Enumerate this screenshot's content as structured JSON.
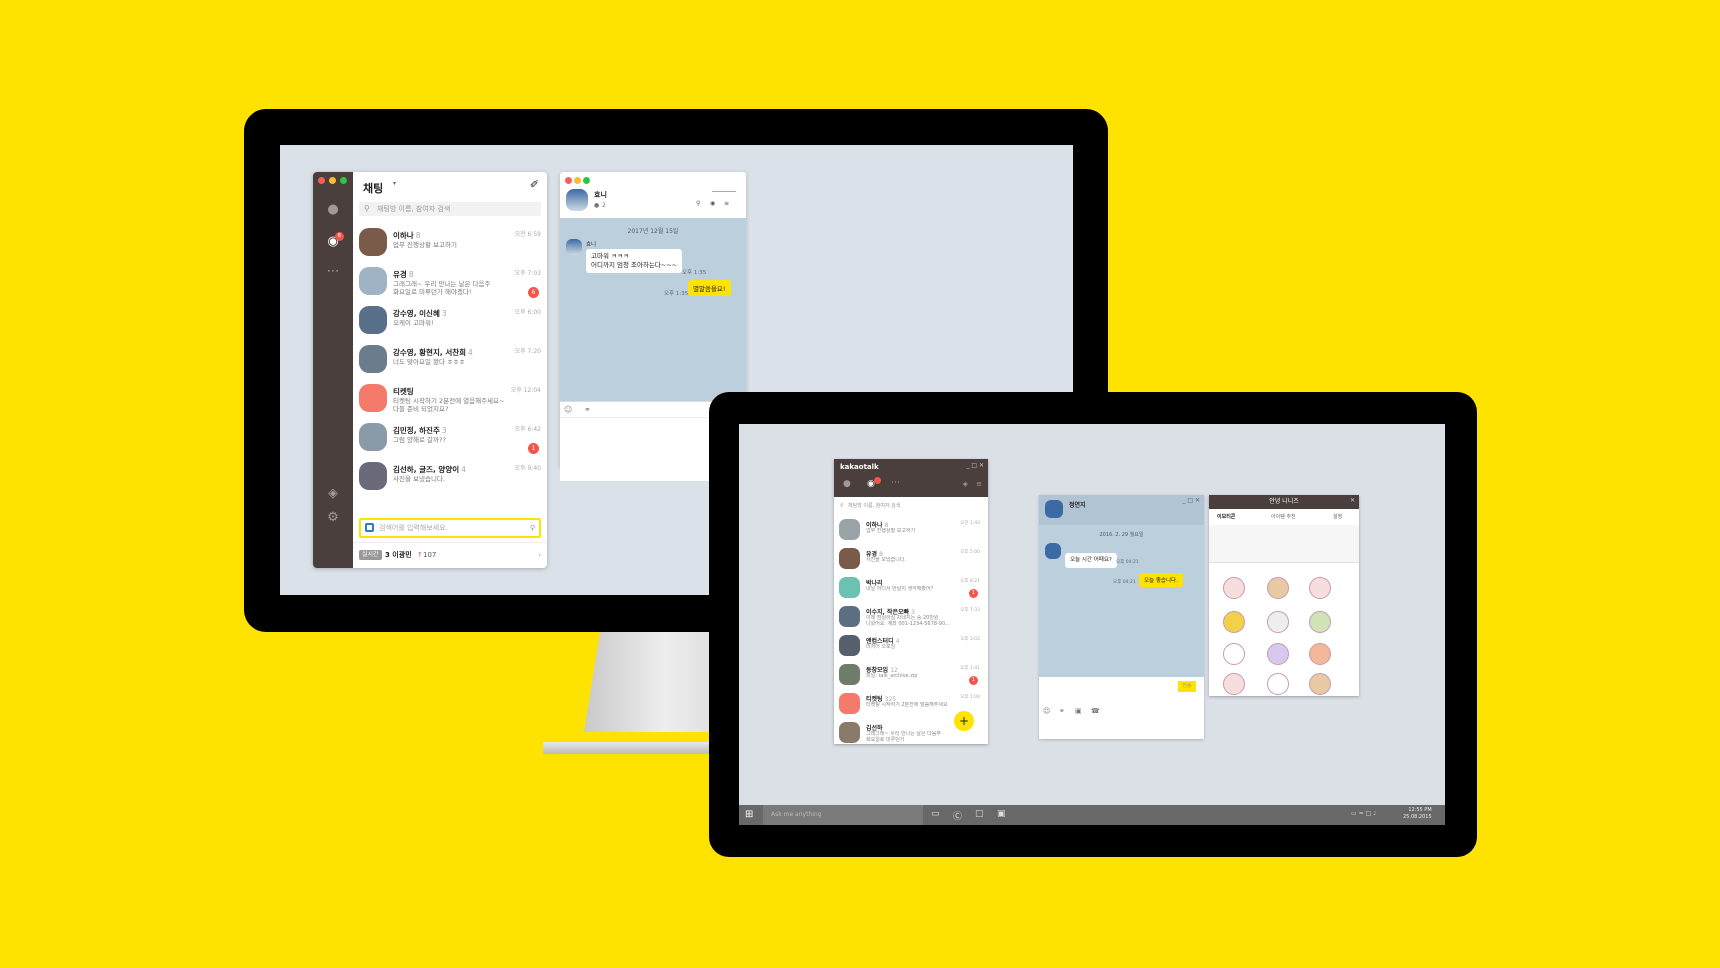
{
  "mac_list": {
    "title": "채팅",
    "search_placeholder": "채팅방 이름, 참여자 검색",
    "unread_badge": "6",
    "chats": [
      {
        "name": "이하나",
        "count": "8",
        "message": "업무 진행상황 보고하기",
        "time": "오전 6:59",
        "badge": ""
      },
      {
        "name": "유경",
        "count": "8",
        "message": "그래그래~ 우리 만나는 날은 다음주\n화요일로 미루던가 해야겠다!",
        "time": "오후 7:03",
        "badge": "6"
      },
      {
        "name": "강수영, 이신혜",
        "count": "3",
        "message": "오케이 고마워!",
        "time": "오후 6:00",
        "badge": ""
      },
      {
        "name": "강수영, 황현지, 서찬희",
        "count": "4",
        "message": "너도 맞아요일 봤다 ㅎㅎㅎ",
        "time": "오후 7:20",
        "badge": ""
      },
      {
        "name": "티켓팅",
        "count": "",
        "message": "티켓팅 시작하기 2분전에 열음해주세요~\n다들 준비 되었지요?",
        "time": "오후 12:04",
        "badge": ""
      },
      {
        "name": "김민정, 하진주",
        "count": "3",
        "message": "그럼 양해로 갈까??",
        "time": "오후 6:42",
        "badge": "1"
      },
      {
        "name": "김선하, 글즈, 양양이",
        "count": "4",
        "message": "사진을 보냈습니다.",
        "time": "오후 9:40",
        "badge": ""
      }
    ],
    "bottom_search_placeholder": "검색어를 입력해보세요.",
    "realtime_label": "실시간",
    "rank_text": "3  이광민",
    "rank_change": "107"
  },
  "mac_room": {
    "name": "효니",
    "members": "2",
    "date": "2017년 12월 15일",
    "sender": "효니",
    "incoming": "고마워 ㅋㅋㅋ\n어디까지 엄청 조아하는다~~~",
    "incoming_time": "오후 1:35",
    "outgoing": "별말씀을요!",
    "outgoing_time": "오후 1:35"
  },
  "win_list": {
    "app_name": "kakaotalk",
    "search_placeholder": "채팅방 이름, 참여자 검색",
    "chats": [
      {
        "name": "이하나",
        "count": "8",
        "message": "업무 진행상황 보고하기",
        "time": "오전 1:40",
        "badge": ""
      },
      {
        "name": "유경",
        "count": "8",
        "message": "사진을 보냈습니다.",
        "time": "오후 5:00",
        "badge": ""
      },
      {
        "name": "박나리",
        "count": "",
        "message": "내일 어디서 만날지 생각해봤어?",
        "time": "오후 8:21",
        "badge": "1"
      },
      {
        "name": "이수지, 작은오빠",
        "count": "3",
        "message": "이제 점심하실 차네지는 중 20만원\n나왔어요. 계좌 001-1234-5678-90...",
        "time": "오후 7:33",
        "badge": ""
      },
      {
        "name": "앤컴스터디",
        "count": "4",
        "message": "마저어 으로잉",
        "time": "오후 3:02",
        "badge": ""
      },
      {
        "name": "동창모임",
        "count": "12",
        "message": "파일: talk_archive.zip",
        "time": "오후 1:41",
        "badge": "1"
      },
      {
        "name": "티켓팅",
        "count": "325",
        "message": "티켓팅 시작하기 2분전에 말씀해주세요",
        "time": "오후 1:04",
        "badge": ""
      },
      {
        "name": "김선하",
        "count": "",
        "message": "그래그래~ 우리 만나는 날은 다음주\n화요일로 미루던가",
        "time": "",
        "badge": ""
      }
    ]
  },
  "win_room": {
    "name": "정연지",
    "date": "2016. 2. 29 월요일",
    "incoming": "오늘 시간 어때요?",
    "incoming_time": "오후 04:21",
    "outgoing": "오늘 좋습니다.",
    "outgoing_time": "오후 04:21",
    "send_label": "전송"
  },
  "win_emo": {
    "title": "안녕 니니즈",
    "tabs": [
      "이모티콘",
      "아이템 추천",
      "설정"
    ]
  },
  "taskbar": {
    "search_placeholder": "Ask me anything",
    "clock": "12:55 PM",
    "date": "25.08.2015"
  }
}
